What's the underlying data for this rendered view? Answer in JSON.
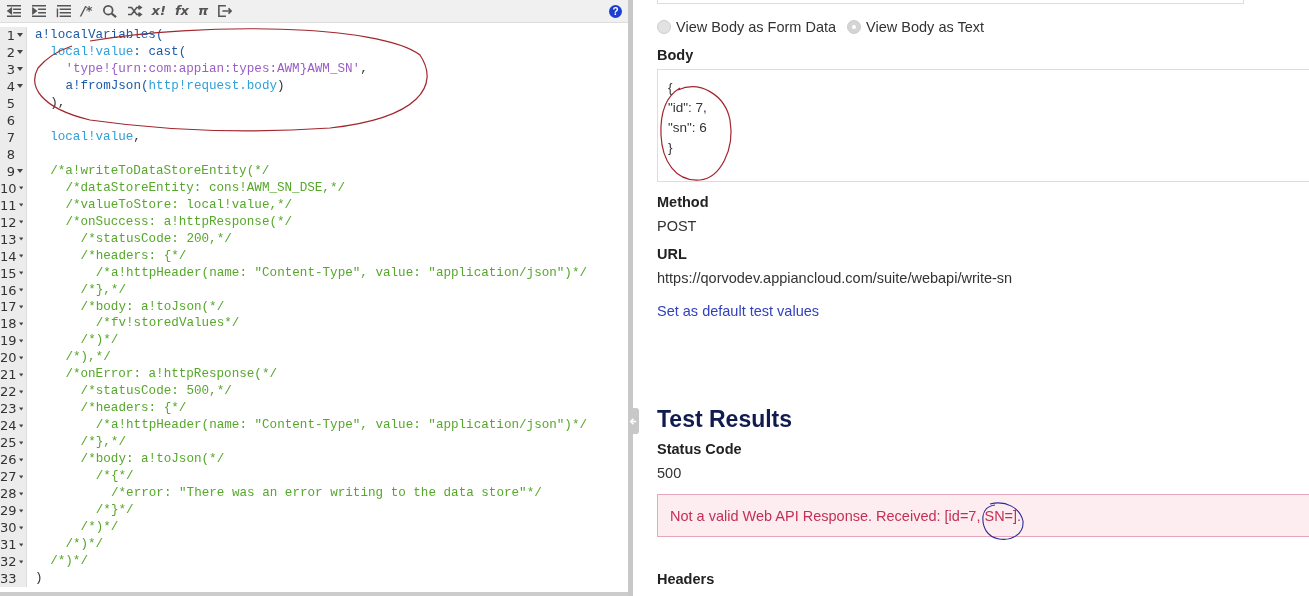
{
  "editor": {
    "toolbar": [
      {
        "kind": "outdent"
      },
      {
        "kind": "indent"
      },
      {
        "kind": "list"
      },
      {
        "kind": "glyph",
        "glyph": "/*"
      },
      {
        "kind": "search"
      },
      {
        "kind": "shuffle"
      },
      {
        "kind": "glyph",
        "glyph": "x!"
      },
      {
        "kind": "glyph",
        "glyph": "fx"
      },
      {
        "kind": "glyph",
        "glyph": "π"
      },
      {
        "kind": "exit"
      }
    ],
    "help": "?",
    "lines": [
      {
        "number": "1",
        "fold": true,
        "tokens": [
          {
            "text": "a!localVariables(",
            "kind": "func"
          }
        ],
        "children": [
          {
            "number": "2",
            "fold": true,
            "tokens": [
              {
                "text": "local!value",
                "kind": "var"
              },
              {
                "text": ": cast(",
                "kind": "func"
              }
            ],
            "children": [
              {
                "number": "3",
                "fold": true,
                "tokens": [
                  {
                    "text": "'type!{urn:com:appian:types:AWM}AWM_SN'",
                    "kind": "string"
                  },
                  {
                    "text": ",",
                    "kind": "plain"
                  }
                ]
              },
              {
                "number": "4",
                "fold": true,
                "tokens": [
                  {
                    "text": "a!fromJson(",
                    "kind": "func"
                  },
                  {
                    "text": "http!request.body",
                    "kind": "var"
                  },
                  {
                    "text": ")",
                    "kind": "plain"
                  }
                ]
              }
            ]
          },
          {
            "number": "5",
            "fold": false,
            "tokens": [
              {
                "text": "),",
                "kind": "plain"
              }
            ]
          },
          {
            "number": "6",
            "fold": false
          },
          {
            "number": "7",
            "fold": false,
            "tokens": [
              {
                "text": "local!value",
                "kind": "var"
              },
              {
                "text": ",",
                "kind": "plain"
              }
            ]
          },
          {
            "number": "8",
            "fold": false
          },
          {
            "number": "9",
            "fold": true,
            "tokens": [
              {
                "text": "/*a!writeToDataStoreEntity(*/",
                "kind": "comment"
              }
            ],
            "children": [
              {
                "number": "10",
                "fold": true,
                "tokens": [
                  {
                    "text": "/*dataStoreEntity: cons!AWM_SN_DSE,*/",
                    "kind": "comment"
                  }
                ]
              },
              {
                "number": "11",
                "fold": true,
                "tokens": [
                  {
                    "text": "/*valueToStore: local!value,*/",
                    "kind": "comment"
                  }
                ]
              },
              {
                "number": "12",
                "fold": true,
                "tokens": [
                  {
                    "text": "/*onSuccess: a!httpResponse(*/",
                    "kind": "comment"
                  }
                ],
                "children": [
                  {
                    "number": "13",
                    "fold": true,
                    "tokens": [
                      {
                        "text": "/*statusCode: 200,*/",
                        "kind": "comment"
                      }
                    ]
                  },
                  {
                    "number": "14",
                    "fold": true,
                    "tokens": [
                      {
                        "text": "/*headers: {*/",
                        "kind": "comment"
                      }
                    ],
                    "children": [
                      {
                        "number": "15",
                        "fold": true,
                        "tokens": [
                          {
                            "text": "/*a!httpHeader(name: \"Content-Type\", value: \"application/json\")*/",
                            "kind": "comment"
                          }
                        ]
                      }
                    ]
                  },
                  {
                    "number": "16",
                    "fold": true,
                    "tokens": [
                      {
                        "text": "/*},*/",
                        "kind": "comment"
                      }
                    ]
                  },
                  {
                    "number": "17",
                    "fold": true,
                    "tokens": [
                      {
                        "text": "/*body: a!toJson(*/",
                        "kind": "comment"
                      }
                    ],
                    "children": [
                      {
                        "number": "18",
                        "fold": true,
                        "tokens": [
                          {
                            "text": "/*fv!storedValues*/",
                            "kind": "comment"
                          }
                        ]
                      }
                    ]
                  },
                  {
                    "number": "19",
                    "fold": true,
                    "tokens": [
                      {
                        "text": "/*)*/",
                        "kind": "comment"
                      }
                    ]
                  }
                ]
              },
              {
                "number": "20",
                "fold": true,
                "tokens": [
                  {
                    "text": "/*),*/",
                    "kind": "comment"
                  }
                ]
              },
              {
                "number": "21",
                "fold": true,
                "tokens": [
                  {
                    "text": "/*onError: a!httpResponse(*/",
                    "kind": "comment"
                  }
                ],
                "children": [
                  {
                    "number": "22",
                    "fold": true,
                    "tokens": [
                      {
                        "text": "/*statusCode: 500,*/",
                        "kind": "comment"
                      }
                    ]
                  },
                  {
                    "number": "23",
                    "fold": true,
                    "tokens": [
                      {
                        "text": "/*headers: {*/",
                        "kind": "comment"
                      }
                    ],
                    "children": [
                      {
                        "number": "24",
                        "fold": true,
                        "tokens": [
                          {
                            "text": "/*a!httpHeader(name: \"Content-Type\", value: \"application/json\")*/",
                            "kind": "comment"
                          }
                        ]
                      }
                    ]
                  },
                  {
                    "number": "25",
                    "fold": true,
                    "tokens": [
                      {
                        "text": "/*},*/",
                        "kind": "comment"
                      }
                    ]
                  },
                  {
                    "number": "26",
                    "fold": true,
                    "tokens": [
                      {
                        "text": "/*body: a!toJson(*/",
                        "kind": "comment"
                      }
                    ],
                    "children": [
                      {
                        "number": "27",
                        "fold": true,
                        "tokens": [
                          {
                            "text": "/*{*/",
                            "kind": "comment"
                          }
                        ],
                        "children": [
                          {
                            "number": "28",
                            "fold": true,
                            "tokens": [
                              {
                                "text": "/*error: \"There was an error writing to the data store\"*/",
                                "kind": "comment"
                              }
                            ]
                          }
                        ]
                      },
                      {
                        "number": "29",
                        "fold": true,
                        "tokens": [
                          {
                            "text": "/*}*/",
                            "kind": "comment"
                          }
                        ]
                      }
                    ]
                  },
                  {
                    "number": "30",
                    "fold": true,
                    "tokens": [
                      {
                        "text": "/*)*/",
                        "kind": "comment"
                      }
                    ]
                  }
                ]
              },
              {
                "number": "31",
                "fold": true,
                "tokens": [
                  {
                    "text": "/*)*/",
                    "kind": "comment"
                  }
                ]
              }
            ]
          },
          {
            "number": "32",
            "fold": true,
            "tokens": [
              {
                "text": "/*)*/",
                "kind": "comment"
              }
            ]
          }
        ]
      },
      {
        "number": "33",
        "fold": false,
        "tokens": [
          {
            "text": ")",
            "kind": "plain"
          }
        ]
      }
    ]
  },
  "request": {
    "body_views": [
      {
        "label": "View Body as Form Data",
        "selected": false
      },
      {
        "label": "View Body as Text",
        "selected": true
      }
    ],
    "body_label": "Body",
    "body_value": "{\n\"id\": 7,\n\"sn\": 6\n}",
    "method_label": "Method",
    "method": "POST",
    "url_label": "URL",
    "url": "https://qorvodev.appiancloud.com/suite/webapi/write-sn",
    "default_link": "Set as default test values"
  },
  "results": {
    "title": "Test Results",
    "status_label": "Status Code",
    "status": "500",
    "error": "Not a valid Web API Response. Received: [id=7, SN=].",
    "headers_label": "Headers"
  }
}
